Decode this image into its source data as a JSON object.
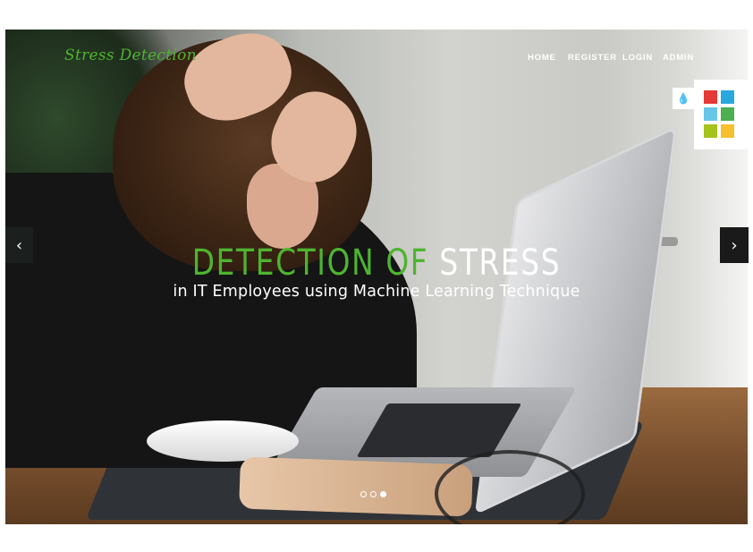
{
  "brand": {
    "name": "Stress Detection"
  },
  "nav": {
    "items": [
      {
        "label": "HOME"
      },
      {
        "label": "REGISTER"
      },
      {
        "label": "LOGIN"
      },
      {
        "label": "ADMIN"
      }
    ]
  },
  "hero": {
    "title_part1": "DETECTION",
    "title_part2": "OF",
    "title_part3": "STRESS",
    "subtitle": "in IT Employees using Machine Learning Technique",
    "prev_arrow": "‹",
    "next_arrow": "›",
    "slides_total": 3,
    "active_slide": 3
  },
  "color_switcher": {
    "toggle_icon": "droplet-icon",
    "swatches": [
      "#e53935",
      "#29a8e0",
      "#66c6e8",
      "#4caf50",
      "#a4c41c",
      "#f6c12c"
    ]
  },
  "colors": {
    "accent": "#4eb430",
    "text_light": "#ffffff"
  }
}
